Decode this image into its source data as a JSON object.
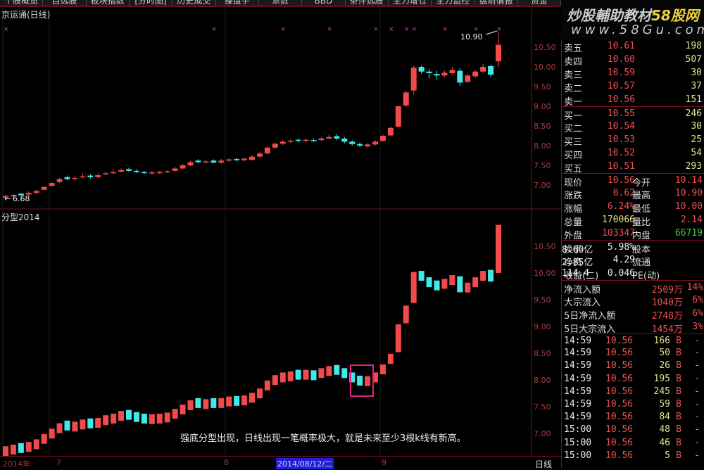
{
  "menu": [
    "个股概览",
    "自选股",
    "板块指数",
    "[分时图]",
    "历史成交",
    "操盘手",
    "系数",
    "BBD",
    "条件选股",
    "主力增仓",
    "主力监控",
    "盘前情报",
    "资金"
  ],
  "upper": {
    "title": "京运通(日线)",
    "high_label": "10.90",
    "low_label": "6.68",
    "axis": [
      "10.50",
      "10.00",
      "9.50",
      "9.00",
      "8.50",
      "8.00",
      "7.50",
      "7.00"
    ]
  },
  "lower": {
    "title": "分型2014",
    "axis": [
      "10.50",
      "10.00",
      "9.50",
      "9.00",
      "8.50",
      "8.00",
      "7.50",
      "7.00"
    ],
    "note": "强底分型出现，日线出现一笔概率极大，就是未来至少3根k线有新高。"
  },
  "time_axis": {
    "year": "2014年",
    "m7": "7",
    "m8": "8",
    "selected_date": "2014/08/12/二",
    "m9": "9",
    "period": "日线"
  },
  "watermark": {
    "line1": "炒股輔助教材",
    "brand": "58股网",
    "line2": "www.58Gu.com"
  },
  "colors": {
    "up": "#f04a4a",
    "down": "#40e8e8",
    "frame": "#7a1020"
  },
  "orderbook": {
    "asks": [
      {
        "l": "卖五",
        "p": "10.61",
        "v": "198"
      },
      {
        "l": "卖四",
        "p": "10.60",
        "v": "507"
      },
      {
        "l": "卖三",
        "p": "10.59",
        "v": "30"
      },
      {
        "l": "卖二",
        "p": "10.57",
        "v": "37"
      },
      {
        "l": "卖一",
        "p": "10.56",
        "v": "151"
      }
    ],
    "bids": [
      {
        "l": "买一",
        "p": "10.55",
        "v": "246"
      },
      {
        "l": "买二",
        "p": "10.54",
        "v": "30"
      },
      {
        "l": "买三",
        "p": "10.53",
        "v": "25"
      },
      {
        "l": "买四",
        "p": "10.52",
        "v": "54"
      },
      {
        "l": "买五",
        "p": "10.51",
        "v": "293"
      }
    ]
  },
  "quote": [
    {
      "l1": "现价",
      "v1": "10.56",
      "l2": "今开",
      "v2": "10.14"
    },
    {
      "l1": "涨跌",
      "v1": "0.62",
      "l2": "最高",
      "v2": "10.90"
    },
    {
      "l1": "涨幅",
      "v1": "6.24%",
      "l2": "最低",
      "v2": "10.00"
    },
    {
      "l1": "总量",
      "v1": "170066",
      "l2": "量比",
      "v2": "2.14"
    },
    {
      "l1": "外盘",
      "v1": "103347",
      "l2": "内盘",
      "v2": "66719"
    }
  ],
  "fund": [
    {
      "l1": "换手",
      "v1": "5.98%",
      "l2": "股本",
      "v2": "8.60亿"
    },
    {
      "l1": "净资",
      "v1": "4.29",
      "l2": "流通",
      "v2": "2.85亿"
    },
    {
      "l1": "收益(二)",
      "v1": "0.046",
      "l2": "PE(动)",
      "v2": "114.4"
    }
  ],
  "flow": [
    {
      "l": "净流入额",
      "v": "2509万",
      "p": "14%"
    },
    {
      "l": "大宗流入",
      "v": "1040万",
      "p": "6%"
    },
    {
      "l": "5日净流入额",
      "v": "2748万",
      "p": "6%"
    },
    {
      "l": "5日大宗流入",
      "v": "1454万",
      "p": "3%"
    }
  ],
  "ticks": [
    {
      "t": "14:59",
      "p": "10.56",
      "v": "166",
      "s": "B"
    },
    {
      "t": "14:59",
      "p": "10.56",
      "v": "50",
      "s": "B"
    },
    {
      "t": "14:59",
      "p": "10.56",
      "v": "26",
      "s": "B"
    },
    {
      "t": "14:59",
      "p": "10.56",
      "v": "195",
      "s": "B"
    },
    {
      "t": "14:59",
      "p": "10.56",
      "v": "245",
      "s": "B"
    },
    {
      "t": "14:59",
      "p": "10.56",
      "v": "59",
      "s": "B"
    },
    {
      "t": "14:59",
      "p": "10.56",
      "v": "84",
      "s": "B"
    },
    {
      "t": "15:00",
      "p": "10.56",
      "v": "48",
      "s": "B"
    },
    {
      "t": "15:00",
      "p": "10.56",
      "v": "46",
      "s": "B"
    },
    {
      "t": "15:00",
      "p": "10.56",
      "v": "5",
      "s": "B"
    }
  ],
  "chart_data": {
    "type": "candlestick",
    "title": "京运通(日线)",
    "ylim": [
      6.6,
      11.0
    ],
    "candles": [
      [
        6.68,
        6.76,
        6.66,
        6.72
      ],
      [
        6.72,
        6.78,
        6.7,
        6.75
      ],
      [
        6.78,
        6.8,
        6.72,
        6.74
      ],
      [
        6.76,
        6.84,
        6.74,
        6.8
      ],
      [
        6.8,
        6.88,
        6.78,
        6.85
      ],
      [
        6.88,
        6.98,
        6.86,
        6.95
      ],
      [
        6.98,
        7.08,
        6.95,
        7.05
      ],
      [
        7.08,
        7.18,
        7.05,
        7.15
      ],
      [
        7.2,
        7.24,
        7.12,
        7.15
      ],
      [
        7.16,
        7.24,
        7.12,
        7.18
      ],
      [
        7.2,
        7.3,
        7.16,
        7.22
      ],
      [
        7.24,
        7.28,
        7.16,
        7.2
      ],
      [
        7.2,
        7.3,
        7.18,
        7.25
      ],
      [
        7.28,
        7.34,
        7.24,
        7.3
      ],
      [
        7.3,
        7.38,
        7.28,
        7.33
      ],
      [
        7.34,
        7.42,
        7.32,
        7.38
      ],
      [
        7.4,
        7.44,
        7.34,
        7.36
      ],
      [
        7.36,
        7.4,
        7.3,
        7.33
      ],
      [
        7.33,
        7.36,
        7.28,
        7.3
      ],
      [
        7.31,
        7.36,
        7.27,
        7.32
      ],
      [
        7.3,
        7.36,
        7.28,
        7.33
      ],
      [
        7.33,
        7.38,
        7.3,
        7.35
      ],
      [
        7.36,
        7.46,
        7.34,
        7.42
      ],
      [
        7.42,
        7.54,
        7.4,
        7.5
      ],
      [
        7.5,
        7.62,
        7.48,
        7.58
      ],
      [
        7.62,
        7.66,
        7.55,
        7.58
      ],
      [
        7.58,
        7.64,
        7.54,
        7.6
      ],
      [
        7.62,
        7.65,
        7.55,
        7.57
      ],
      [
        7.57,
        7.66,
        7.54,
        7.62
      ],
      [
        7.62,
        7.68,
        7.58,
        7.65
      ],
      [
        7.66,
        7.7,
        7.6,
        7.63
      ],
      [
        7.63,
        7.7,
        7.6,
        7.67
      ],
      [
        7.64,
        7.76,
        7.62,
        7.72
      ],
      [
        7.72,
        7.84,
        7.7,
        7.8
      ],
      [
        7.8,
        7.98,
        7.78,
        7.95
      ],
      [
        7.95,
        8.08,
        7.92,
        8.05
      ],
      [
        8.05,
        8.14,
        8.02,
        8.1
      ],
      [
        8.1,
        8.16,
        8.06,
        8.12
      ],
      [
        8.15,
        8.18,
        8.08,
        8.12
      ],
      [
        8.12,
        8.18,
        8.08,
        8.15
      ],
      [
        8.14,
        8.18,
        8.1,
        8.13
      ],
      [
        8.14,
        8.22,
        8.12,
        8.18
      ],
      [
        8.18,
        8.28,
        8.16,
        8.22
      ],
      [
        8.24,
        8.3,
        8.14,
        8.18
      ],
      [
        8.18,
        8.22,
        8.06,
        8.1
      ],
      [
        8.1,
        8.14,
        8.0,
        8.04
      ],
      [
        8.04,
        8.08,
        7.96,
        8.0
      ],
      [
        7.98,
        8.06,
        7.95,
        8.03
      ],
      [
        8.03,
        8.14,
        8.0,
        8.1
      ],
      [
        8.12,
        8.28,
        8.1,
        8.25
      ],
      [
        8.26,
        8.48,
        8.24,
        8.45
      ],
      [
        8.48,
        9.02,
        8.46,
        9.0
      ],
      [
        9.02,
        9.4,
        8.98,
        9.35
      ],
      [
        9.4,
        10.02,
        9.3,
        9.98
      ],
      [
        10.0,
        10.04,
        9.82,
        9.88
      ],
      [
        9.88,
        9.94,
        9.7,
        9.84
      ],
      [
        9.82,
        9.9,
        9.66,
        9.78
      ],
      [
        9.78,
        9.9,
        9.74,
        9.85
      ],
      [
        9.84,
        10.0,
        9.8,
        9.92
      ],
      [
        9.9,
        9.96,
        9.52,
        9.6
      ],
      [
        9.62,
        9.82,
        9.58,
        9.78
      ],
      [
        9.76,
        9.92,
        9.72,
        9.88
      ],
      [
        9.88,
        10.08,
        9.84,
        10.0
      ],
      [
        10.02,
        10.05,
        9.74,
        9.8
      ],
      [
        10.14,
        10.9,
        10.0,
        10.56
      ]
    ]
  }
}
